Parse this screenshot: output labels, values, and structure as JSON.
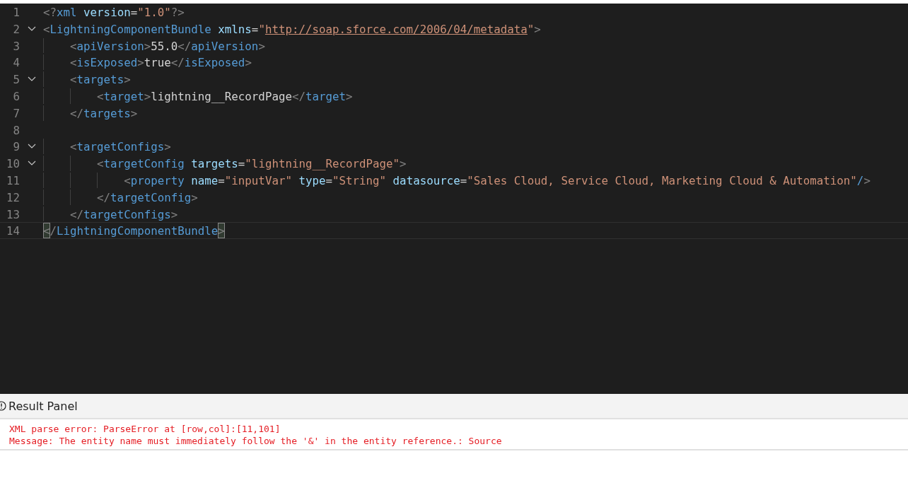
{
  "editor": {
    "lines": [
      {
        "number": "1",
        "foldable": false,
        "current": false,
        "tokens": [
          {
            "kind": "punct",
            "text": "<?"
          },
          {
            "kind": "tag",
            "text": "xml"
          },
          {
            "kind": "attr",
            "text": " version"
          },
          {
            "kind": "plain",
            "text": "="
          },
          {
            "kind": "string",
            "text": "\"1.0\""
          },
          {
            "kind": "punct",
            "text": "?>"
          }
        ]
      },
      {
        "number": "2",
        "foldable": true,
        "current": false,
        "tokens": [
          {
            "kind": "punct",
            "text": "<"
          },
          {
            "kind": "tag",
            "text": "LightningComponentBundle"
          },
          {
            "kind": "attr",
            "text": " xmlns"
          },
          {
            "kind": "plain",
            "text": "="
          },
          {
            "kind": "string",
            "text": "\""
          },
          {
            "kind": "link",
            "text": "http://soap.sforce.com/2006/04/metadata"
          },
          {
            "kind": "string",
            "text": "\""
          },
          {
            "kind": "punct",
            "text": ">"
          }
        ]
      },
      {
        "number": "3",
        "foldable": false,
        "current": false,
        "tokens": [
          {
            "kind": "punct",
            "text": "    <"
          },
          {
            "kind": "tag",
            "text": "apiVersion"
          },
          {
            "kind": "punct",
            "text": ">"
          },
          {
            "kind": "plain",
            "text": "55.0"
          },
          {
            "kind": "punct",
            "text": "</"
          },
          {
            "kind": "tag",
            "text": "apiVersion"
          },
          {
            "kind": "punct",
            "text": ">"
          }
        ]
      },
      {
        "number": "4",
        "foldable": false,
        "current": false,
        "tokens": [
          {
            "kind": "punct",
            "text": "    <"
          },
          {
            "kind": "tag",
            "text": "isExposed"
          },
          {
            "kind": "punct",
            "text": ">"
          },
          {
            "kind": "plain",
            "text": "true"
          },
          {
            "kind": "punct",
            "text": "</"
          },
          {
            "kind": "tag",
            "text": "isExposed"
          },
          {
            "kind": "punct",
            "text": ">"
          }
        ]
      },
      {
        "number": "5",
        "foldable": true,
        "current": false,
        "tokens": [
          {
            "kind": "punct",
            "text": "    <"
          },
          {
            "kind": "tag",
            "text": "targets"
          },
          {
            "kind": "punct",
            "text": ">"
          }
        ]
      },
      {
        "number": "6",
        "foldable": false,
        "current": false,
        "tokens": [
          {
            "kind": "punct",
            "text": "        <"
          },
          {
            "kind": "tag",
            "text": "target"
          },
          {
            "kind": "punct",
            "text": ">"
          },
          {
            "kind": "plain",
            "text": "lightning__RecordPage"
          },
          {
            "kind": "punct",
            "text": "</"
          },
          {
            "kind": "tag",
            "text": "target"
          },
          {
            "kind": "punct",
            "text": ">"
          }
        ]
      },
      {
        "number": "7",
        "foldable": false,
        "current": false,
        "tokens": [
          {
            "kind": "punct",
            "text": "    </"
          },
          {
            "kind": "tag",
            "text": "targets"
          },
          {
            "kind": "punct",
            "text": ">"
          }
        ]
      },
      {
        "number": "8",
        "foldable": false,
        "current": false
      },
      {
        "number": "9",
        "foldable": true,
        "current": false,
        "tokens": [
          {
            "kind": "punct",
            "text": "    <"
          },
          {
            "kind": "tag",
            "text": "targetConfigs"
          },
          {
            "kind": "punct",
            "text": ">"
          }
        ]
      },
      {
        "number": "10",
        "foldable": true,
        "current": false,
        "tokens": [
          {
            "kind": "punct",
            "text": "        <"
          },
          {
            "kind": "tag",
            "text": "targetConfig"
          },
          {
            "kind": "attr",
            "text": " targets"
          },
          {
            "kind": "plain",
            "text": "="
          },
          {
            "kind": "string",
            "text": "\"lightning__RecordPage\""
          },
          {
            "kind": "punct",
            "text": ">"
          }
        ]
      },
      {
        "number": "11",
        "foldable": false,
        "current": false,
        "tokens": [
          {
            "kind": "punct",
            "text": "            <"
          },
          {
            "kind": "tag",
            "text": "property"
          },
          {
            "kind": "attr",
            "text": " name"
          },
          {
            "kind": "plain",
            "text": "="
          },
          {
            "kind": "string",
            "text": "\"inputVar\""
          },
          {
            "kind": "attr",
            "text": " type"
          },
          {
            "kind": "plain",
            "text": "="
          },
          {
            "kind": "string",
            "text": "\"String\""
          },
          {
            "kind": "attr",
            "text": " datasource"
          },
          {
            "kind": "plain",
            "text": "="
          },
          {
            "kind": "string",
            "text": "\"Sales Cloud, Service Cloud, Marketing Cloud & Automation\""
          },
          {
            "kind": "tag",
            "text": "/"
          },
          {
            "kind": "punct",
            "text": ">"
          }
        ]
      },
      {
        "number": "12",
        "foldable": false,
        "current": false,
        "tokens": [
          {
            "kind": "punct",
            "text": "        </"
          },
          {
            "kind": "tag",
            "text": "targetConfig"
          },
          {
            "kind": "punct",
            "text": ">"
          }
        ]
      },
      {
        "number": "13",
        "foldable": false,
        "current": false,
        "tokens": [
          {
            "kind": "punct",
            "text": "    </"
          },
          {
            "kind": "tag",
            "text": "targetConfigs"
          },
          {
            "kind": "punct",
            "text": ">"
          }
        ]
      },
      {
        "number": "14",
        "foldable": false,
        "current": true,
        "tokens": [
          {
            "kind": "bracket",
            "text": "<"
          },
          {
            "kind": "punct",
            "text": "/"
          },
          {
            "kind": "tag",
            "text": "LightningComponentBundle"
          },
          {
            "kind": "bracket",
            "text": ">"
          }
        ]
      }
    ]
  },
  "result_panel": {
    "title": "Result Panel",
    "messages": [
      "XML parse error: ParseError at [row,col]:[11,101]",
      "Message: The entity name must immediately follow the '&' in the entity reference.: Source"
    ]
  }
}
